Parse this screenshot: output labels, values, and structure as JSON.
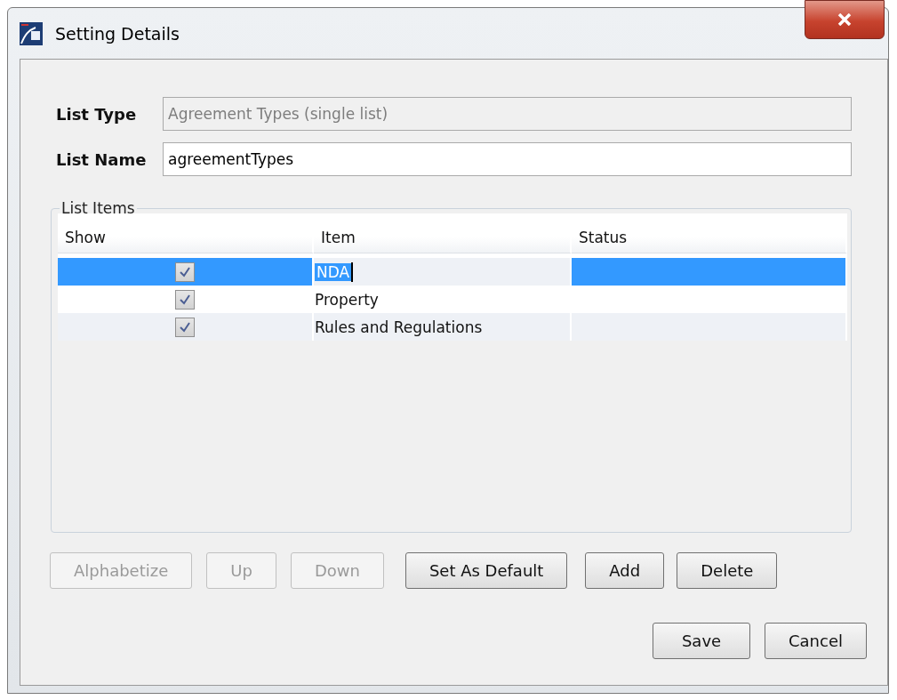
{
  "window": {
    "title": "Setting Details"
  },
  "list_type": {
    "label": "List Type",
    "value": "Agreement Types (single list)",
    "disabled": true
  },
  "list_name": {
    "label": "List Name",
    "value": "agreementTypes",
    "disabled": false
  },
  "list_items": {
    "legend": "List Items",
    "columns": [
      "Show",
      "Item",
      "Status"
    ],
    "rows": [
      {
        "show": true,
        "item": "NDA",
        "selected": true
      },
      {
        "show": true,
        "item": "Property",
        "selected": false
      },
      {
        "show": true,
        "item": "Rules and Regulations",
        "selected": false
      }
    ]
  },
  "list_buttons": [
    {
      "label": "Alphabetize",
      "disabled": true
    },
    {
      "label": "Up",
      "disabled": true
    },
    {
      "label": "Down",
      "disabled": true
    },
    {
      "label": "Set As Default",
      "disabled": false
    },
    {
      "label": "Add",
      "disabled": false
    },
    {
      "label": "Delete",
      "disabled": false
    }
  ],
  "dialog_buttons": [
    {
      "label": "Save",
      "disabled": false
    },
    {
      "label": "Cancel",
      "disabled": false
    }
  ]
}
